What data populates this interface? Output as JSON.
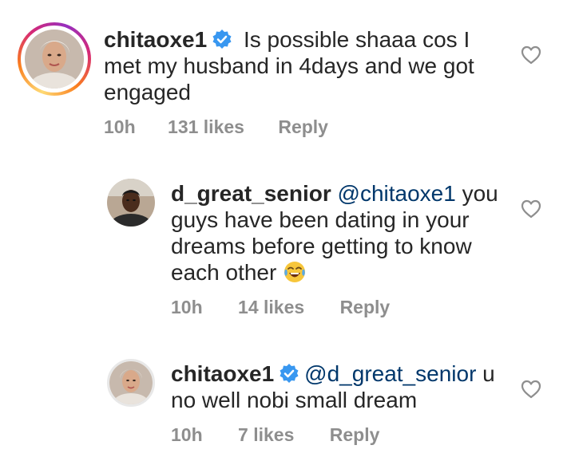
{
  "comments": [
    {
      "username": "chitaoxe1",
      "verified": true,
      "mention": "",
      "text": " Is possible shaaa cos I met my husband in 4days and we got engaged",
      "time": "10h",
      "likes": "131 likes",
      "reply_label": "Reply",
      "avatar_icon": "profile-photo-woman"
    },
    {
      "username": "d_great_senior",
      "verified": false,
      "mention": "@chitaoxe1",
      "text": " you guys have been dating in your dreams before getting to know each other ",
      "emoji": "tears-of-joy-emoji",
      "time": "10h",
      "likes": "14 likes",
      "reply_label": "Reply",
      "avatar_icon": "profile-photo-man"
    },
    {
      "username": "chitaoxe1",
      "verified": true,
      "mention": "@d_great_senior",
      "text": " u no well nobi small dream",
      "time": "10h",
      "likes": "7 likes",
      "reply_label": "Reply",
      "avatar_icon": "profile-photo-woman"
    }
  ],
  "colors": {
    "text": "#262626",
    "mention": "#00376b",
    "meta": "#8e8e8e",
    "verified": "#3897f0"
  }
}
